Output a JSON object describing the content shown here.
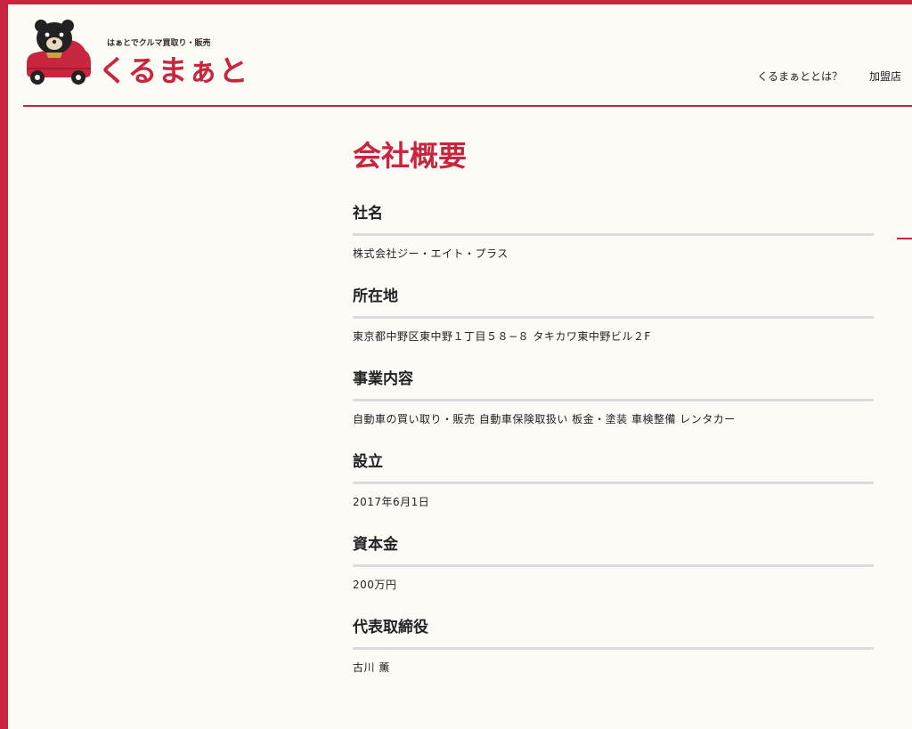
{
  "brand": {
    "tagline": "はぁとでクルマ買取り・販売",
    "name": "くるまぁと",
    "colors": {
      "accent": "#c8253f",
      "rule": "#dcdcdc",
      "background": "#fdfbf6"
    },
    "icon": "bear-in-car-logo"
  },
  "nav": {
    "items": [
      {
        "label": "くるまぁととは？"
      },
      {
        "label": "加盟店"
      }
    ]
  },
  "page": {
    "title": "会社概要"
  },
  "company": {
    "sections": [
      {
        "heading": "社名",
        "value": "株式会社ジー・エイト・プラス"
      },
      {
        "heading": "所在地",
        "value": "東京都中野区東中野１丁目５８−８ タキカワ東中野ビル２F"
      },
      {
        "heading": "事業内容",
        "value": "自動車の買い取り・販売 自動車保険取扱い 板金・塗装 車検整備 レンタカー"
      },
      {
        "heading": "設立",
        "value": "2017年6月1日"
      },
      {
        "heading": "資本金",
        "value": "200万円"
      },
      {
        "heading": "代表取締役",
        "value": "古川 薫"
      }
    ]
  }
}
